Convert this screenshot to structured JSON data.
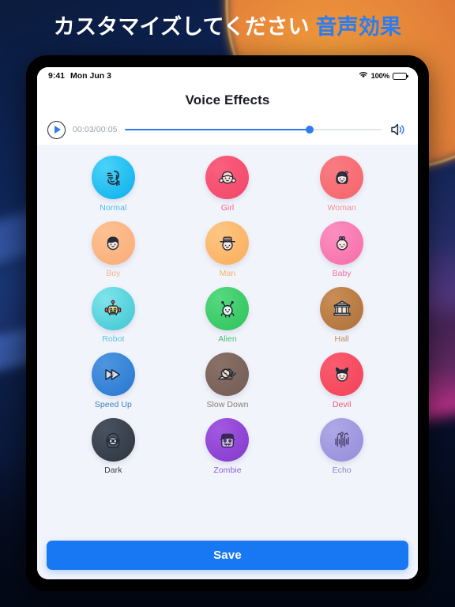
{
  "headline": {
    "text_white": "カスタマイズしてください",
    "text_accent": "音声効果",
    "accent_color": "#2b7ef0"
  },
  "status_bar": {
    "time": "9:41",
    "date": "Mon Jun 3",
    "battery_percent": "100%",
    "wifi_icon": "wifi-icon",
    "battery_icon": "battery-full-icon"
  },
  "app": {
    "title": "Voice Effects"
  },
  "player": {
    "play_icon": "play-circle-icon",
    "time_text": "00:03/00:05",
    "elapsed": "00:03",
    "duration": "00:05",
    "progress_percent": 72,
    "volume_icon": "speaker-wave-icon",
    "track_fill_color": "#2f7bf0",
    "track_bg_color": "#e2e6f0"
  },
  "effects": [
    {
      "id": "normal",
      "label": "Normal",
      "icon": "voice-wave-face-icon",
      "bubble_from": "#4ad3f7",
      "bubble_to": "#17b6ef",
      "label_color": "#4fb8e8",
      "selected": true
    },
    {
      "id": "girl",
      "label": "Girl",
      "icon": "girl-face-icon",
      "bubble_from": "#fb5f7e",
      "bubble_to": "#f44b6c",
      "label_color": "#f4627f",
      "selected": false
    },
    {
      "id": "woman",
      "label": "Woman",
      "icon": "woman-face-icon",
      "bubble_from": "#fa7b82",
      "bubble_to": "#f6696f",
      "label_color": "#f68b90",
      "selected": false
    },
    {
      "id": "boy",
      "label": "Boy",
      "icon": "boy-face-icon",
      "bubble_from": "#fcc193",
      "bubble_to": "#fbb07b",
      "label_color": "#f7b387",
      "selected": false
    },
    {
      "id": "man",
      "label": "Man",
      "icon": "man-hat-face-icon",
      "bubble_from": "#fdc683",
      "bubble_to": "#fbb263",
      "label_color": "#f5ae68",
      "selected": false
    },
    {
      "id": "baby",
      "label": "Baby",
      "icon": "baby-face-icon",
      "bubble_from": "#fb8fc0",
      "bubble_to": "#f873ad",
      "label_color": "#f16fa6",
      "selected": false
    },
    {
      "id": "robot",
      "label": "Robot",
      "icon": "robot-head-icon",
      "bubble_from": "#7fe4ea",
      "bubble_to": "#4cccd8",
      "label_color": "#55c6d6",
      "selected": false
    },
    {
      "id": "alien",
      "label": "Alien",
      "icon": "alien-icon",
      "bubble_from": "#56d97f",
      "bubble_to": "#36c762",
      "label_color": "#3fc368",
      "selected": false
    },
    {
      "id": "hall",
      "label": "Hall",
      "icon": "hall-building-icon",
      "bubble_from": "#c98d57",
      "bubble_to": "#b3763f",
      "label_color": "#bd8a5d",
      "selected": false
    },
    {
      "id": "speed_up",
      "label": "Speed Up",
      "icon": "fast-forward-icon",
      "bubble_from": "#4e95e0",
      "bubble_to": "#2f7ed4",
      "label_color": "#3a7fc4",
      "selected": false
    },
    {
      "id": "slow_down",
      "label": "Slow Down",
      "icon": "snail-icon",
      "bubble_from": "#8a7167",
      "bubble_to": "#776058",
      "label_color": "#8b7a73",
      "selected": false
    },
    {
      "id": "devil",
      "label": "Devil",
      "icon": "devil-face-icon",
      "bubble_from": "#fa5c6e",
      "bubble_to": "#f4475c",
      "label_color": "#f0576b",
      "selected": false
    },
    {
      "id": "dark",
      "label": "Dark",
      "icon": "ninja-face-icon",
      "bubble_from": "#4a5260",
      "bubble_to": "#343b47",
      "label_color": "#3b3f48",
      "selected": false
    },
    {
      "id": "zombie",
      "label": "Zombie",
      "icon": "zombie-face-icon",
      "bubble_from": "#a259e0",
      "bubble_to": "#8a3fd0",
      "label_color": "#8d5fd3",
      "selected": false
    },
    {
      "id": "echo",
      "label": "Echo",
      "icon": "echo-wave-icon",
      "bubble_from": "#afa9e6",
      "bubble_to": "#9a92dd",
      "label_color": "#8a84c8",
      "selected": false
    }
  ],
  "footer": {
    "save_label": "Save",
    "save_color": "#1877f2"
  }
}
